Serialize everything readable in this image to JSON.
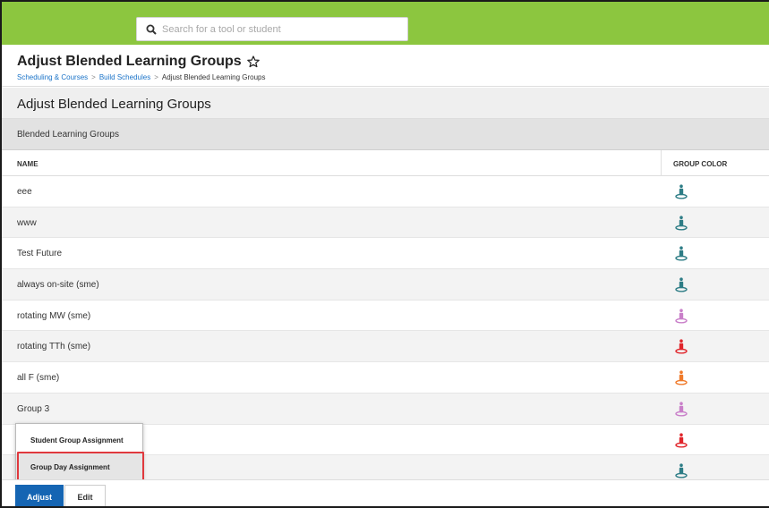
{
  "search": {
    "placeholder": "Search for a tool or student"
  },
  "header": {
    "title": "Adjust Blended Learning Groups",
    "breadcrumb": [
      "Scheduling & Courses",
      "Build Schedules",
      "Adjust Blended Learning Groups"
    ]
  },
  "section": {
    "title": "Adjust Blended Learning Groups"
  },
  "panel": {
    "title": "Blended Learning Groups"
  },
  "table": {
    "columns": {
      "name": "NAME",
      "color": "GROUP COLOR"
    },
    "rows": [
      {
        "name": "eee",
        "color": "#2e7d86"
      },
      {
        "name": "www",
        "color": "#2e7d86"
      },
      {
        "name": "Test Future",
        "color": "#2e7d86"
      },
      {
        "name": "always on-site (sme)",
        "color": "#2e7d86"
      },
      {
        "name": "rotating MW (sme)",
        "color": "#c97fc9"
      },
      {
        "name": "rotating TTh (sme)",
        "color": "#e0252b"
      },
      {
        "name": "all F (sme)",
        "color": "#f07a2a"
      },
      {
        "name": "Group 3",
        "color": "#c97fc9"
      },
      {
        "name": "",
        "color": "#e0252b"
      },
      {
        "name": "",
        "color": "#2e7d86"
      }
    ]
  },
  "popup": {
    "items": [
      "Student Group Assignment",
      "Group Day Assignment"
    ]
  },
  "footer": {
    "adjust_label": "Adjust",
    "edit_label": "Edit"
  },
  "colors": {
    "topbar": "#8cc63f",
    "primary_button": "#1565b3",
    "highlight": "#e0393e",
    "link": "#1a73c8"
  }
}
